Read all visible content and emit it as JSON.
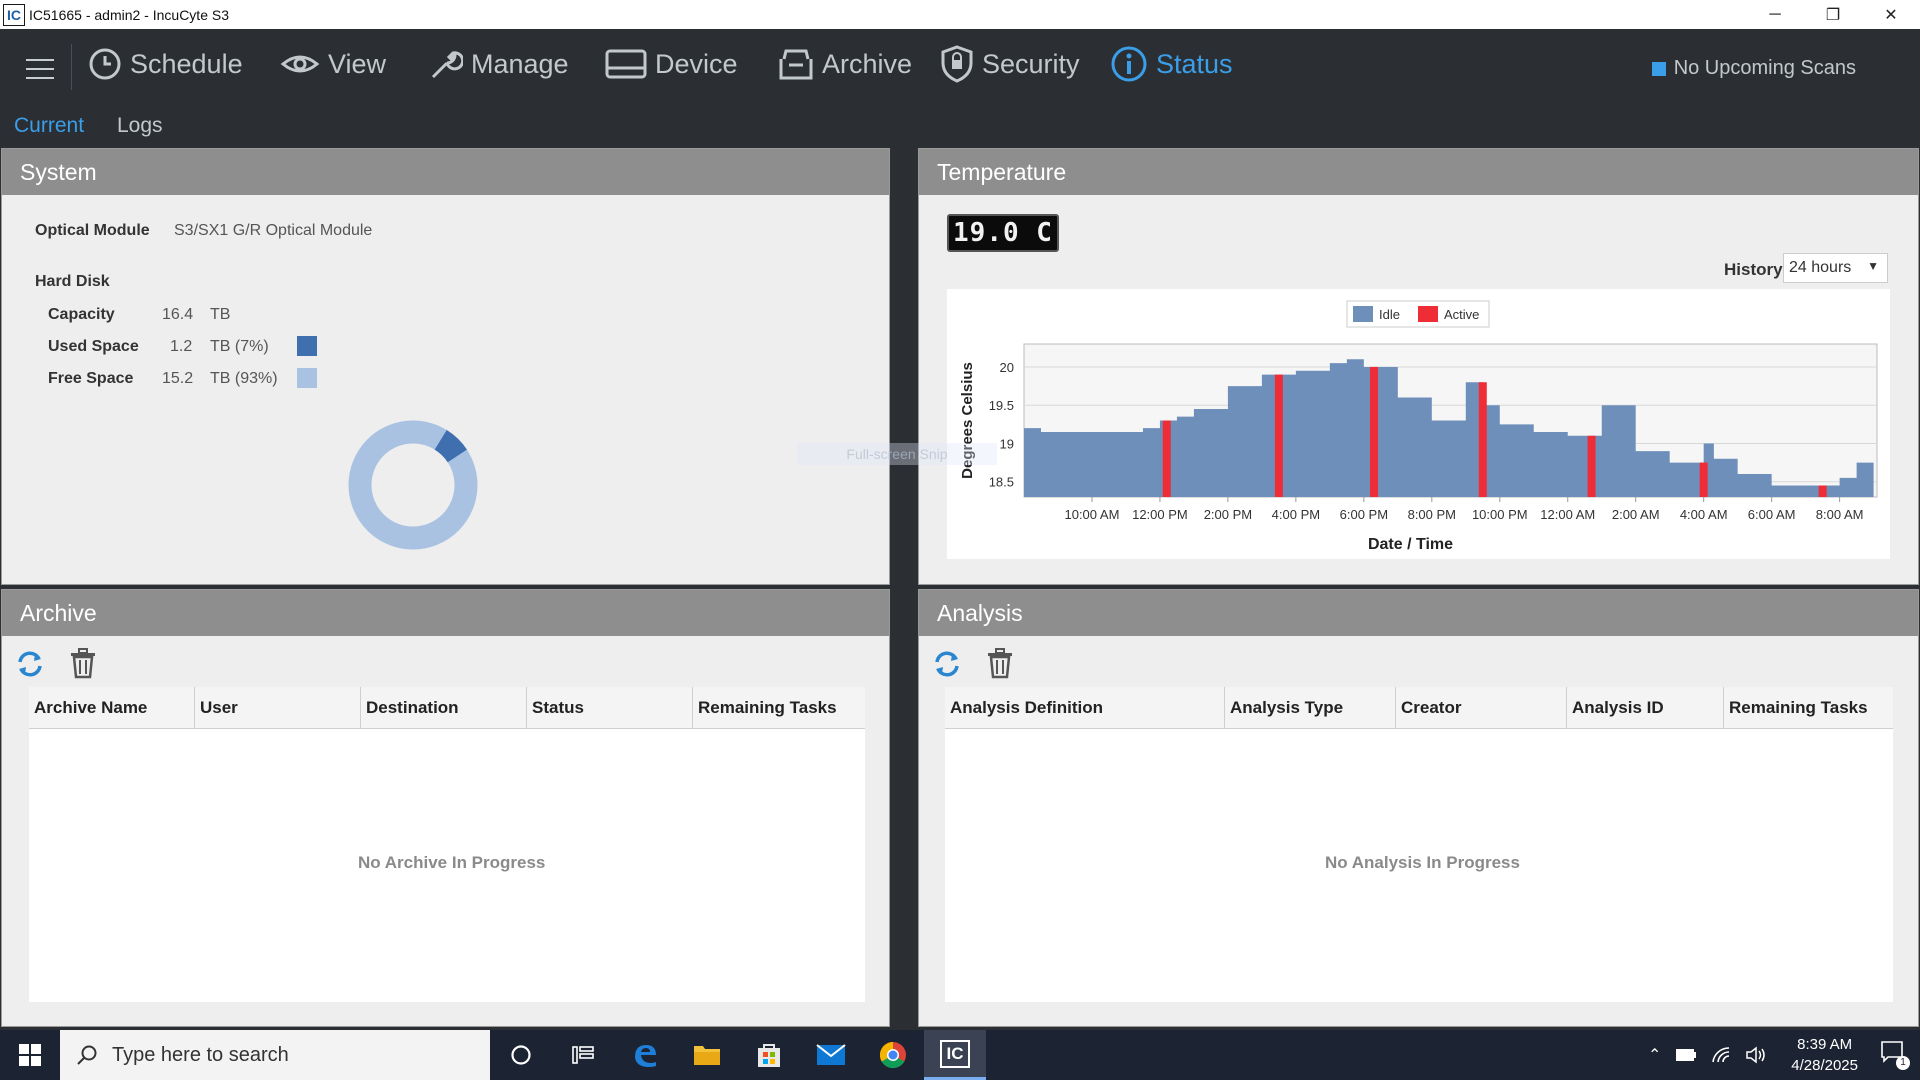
{
  "window": {
    "app_badge": "IC",
    "title": "IC51665 - admin2 - IncuCyte S3",
    "minimize": "─",
    "restore": "❐",
    "close": "✕"
  },
  "nav": {
    "items": [
      {
        "label": "Schedule",
        "icon": "clock-icon"
      },
      {
        "label": "View",
        "icon": "eye-icon"
      },
      {
        "label": "Manage",
        "icon": "wrench-icon"
      },
      {
        "label": "Device",
        "icon": "device-icon"
      },
      {
        "label": "Archive",
        "icon": "archive-box-icon"
      },
      {
        "label": "Security",
        "icon": "shield-icon"
      },
      {
        "label": "Status",
        "icon": "info-icon",
        "active": true
      }
    ],
    "scans_status": "No Upcoming Scans",
    "subtabs": [
      "Current",
      "Logs"
    ],
    "active_subtab": "Current"
  },
  "system": {
    "title": "System",
    "optical_module_label": "Optical Module",
    "optical_module_value": "S3/SX1 G/R Optical Module",
    "hard_disk_label": "Hard Disk",
    "capacity_label": "Capacity",
    "capacity_value": "16.4",
    "capacity_unit": "TB",
    "used_label": "Used Space",
    "used_value": "1.2",
    "used_unit": "TB (7%)",
    "free_label": "Free Space",
    "free_value": "15.2",
    "free_unit": "TB (93%)",
    "used_fraction": 0.07,
    "used_color": "#3f6fae",
    "free_color": "#a9c2e2"
  },
  "temperature": {
    "title": "Temperature",
    "display": "19.0 C",
    "history_label": "History",
    "history_value": "24 hours",
    "overlay_text": "Full-screen Snip"
  },
  "chart_data": {
    "type": "area",
    "title": "",
    "xlabel": "Date / Time",
    "ylabel": "Degrees Celsius",
    "ylim": [
      18.3,
      20.3
    ],
    "yticks": [
      18.5,
      19,
      19.5,
      20
    ],
    "xticks": [
      "10:00 AM",
      "12:00 PM",
      "2:00 PM",
      "4:00 PM",
      "6:00 PM",
      "8:00 PM",
      "10:00 PM",
      "12:00 AM",
      "2:00 AM",
      "4:00 AM",
      "6:00 AM",
      "8:00 AM"
    ],
    "legend": [
      {
        "name": "Idle",
        "color": "#6f8fbb"
      },
      {
        "name": "Active",
        "color": "#ee2d37"
      }
    ],
    "legend_position": "top-center",
    "series_hours_offset_start": "8:00 AM",
    "idle": {
      "x_hours": [
        8.0,
        8.5,
        9,
        10,
        11,
        11.5,
        12,
        12.5,
        13,
        14,
        15,
        16,
        17,
        17.5,
        18,
        19,
        20,
        21,
        21.5,
        22,
        23,
        24,
        25,
        26,
        27,
        28,
        28.3,
        29,
        30,
        31,
        32,
        32.5,
        33
      ],
      "y": [
        19.2,
        19.15,
        19.15,
        19.15,
        19.15,
        19.2,
        19.3,
        19.35,
        19.45,
        19.75,
        19.9,
        19.95,
        20.05,
        20.1,
        20.0,
        19.6,
        19.3,
        19.8,
        19.5,
        19.25,
        19.15,
        19.1,
        19.5,
        18.9,
        18.75,
        19.0,
        18.8,
        18.6,
        18.45,
        18.45,
        18.55,
        18.75,
        19.0
      ]
    },
    "active_at_hours": [
      12.2,
      15.5,
      18.3,
      21.5,
      24.7,
      28.0,
      31.5
    ]
  },
  "archive": {
    "title": "Archive",
    "refresh_icon": "refresh-icon",
    "delete_icon": "trash-icon",
    "columns": [
      "Archive Name",
      "User",
      "Destination",
      "Status",
      "Remaining Tasks"
    ],
    "empty_text": "No Archive In Progress"
  },
  "analysis": {
    "title": "Analysis",
    "refresh_icon": "refresh-icon",
    "delete_icon": "trash-icon",
    "columns": [
      "Analysis Definition",
      "Analysis Type",
      "Creator",
      "Analysis ID",
      "Remaining Tasks"
    ],
    "empty_text": "No Analysis In Progress"
  },
  "taskbar": {
    "search_placeholder": "Type here to search",
    "time": "8:39 AM",
    "date": "4/28/2025",
    "notification_count": "1"
  }
}
